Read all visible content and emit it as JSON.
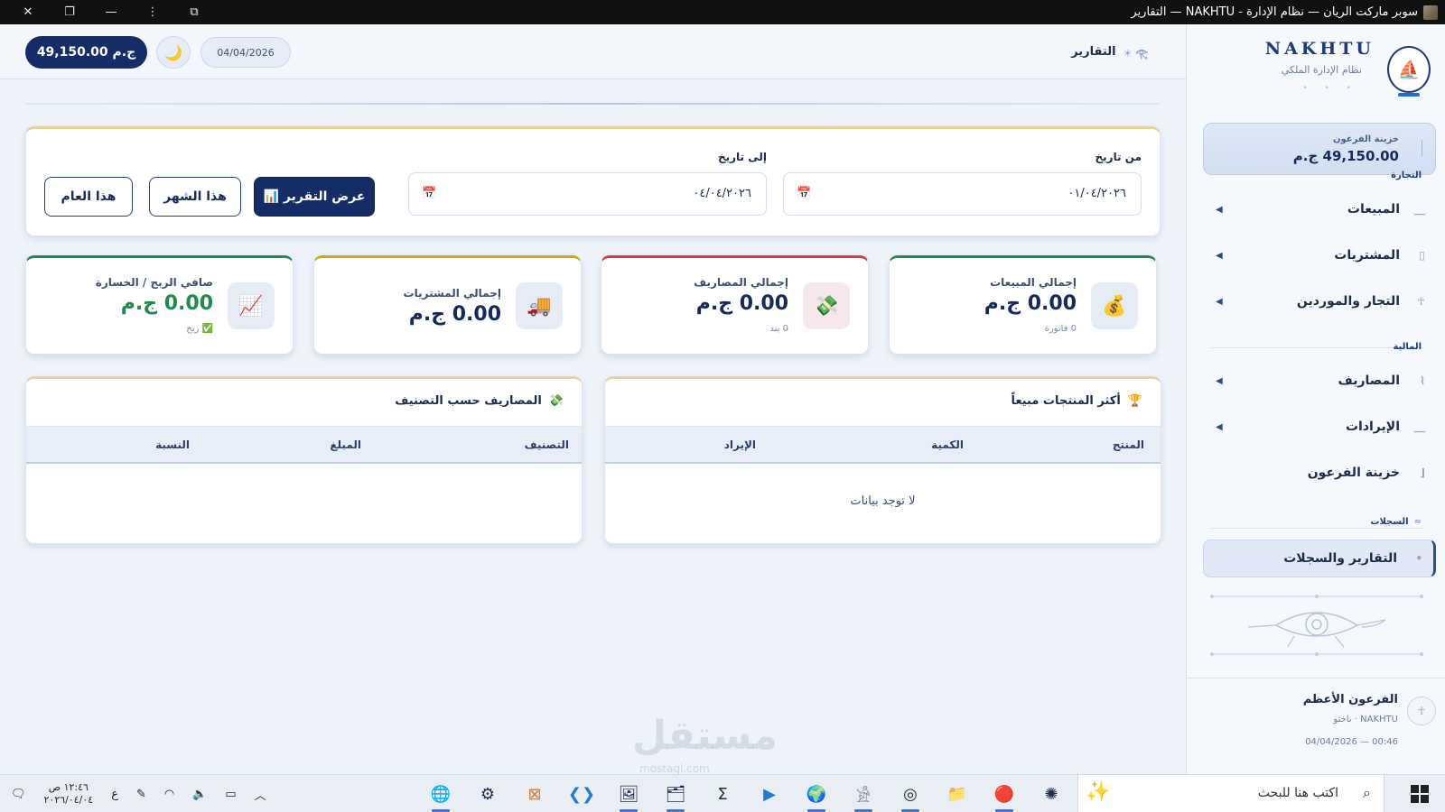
{
  "window": {
    "title": "سوبر ماركت الريان — نظام الإدارة - NAKHTU — التقارير",
    "close": "✕",
    "restore": "❐",
    "minimize": "—",
    "menu": "⋮"
  },
  "sidebar": {
    "brand_name": "NAKHTU",
    "brand_sub": "نظام الإدارة الملكي",
    "treasury_label": "خزينة الفرعون",
    "treasury_value": "49,150.00 ج.م",
    "section_trade": "التجارة",
    "section_finance": "المالية",
    "section_records": "السجلات",
    "items": [
      {
        "label": "المبيعات",
        "icon": "sales-icon",
        "arrow": "◀"
      },
      {
        "label": "المشتريات",
        "icon": "purchases-icon",
        "arrow": "◀"
      },
      {
        "label": "التجار والموردين",
        "icon": "suppliers-icon",
        "arrow": "◀"
      },
      {
        "label": "المصاريف",
        "icon": "expenses-icon",
        "arrow": "◀"
      },
      {
        "label": "الإيرادات",
        "icon": "revenue-icon",
        "arrow": "◀"
      },
      {
        "label": "خزينة الفرعون",
        "icon": "treasury-icon",
        "arrow": ""
      },
      {
        "label": "التقارير والسجلات",
        "icon": "reports-icon",
        "arrow": ""
      }
    ],
    "user_name": "الفرعون الأعظم",
    "user_sub": "NAKHTU · ناختو",
    "user_time": "04/04/2026 — 00:46"
  },
  "header": {
    "title": "التقارير",
    "balance": "49,150.00 ج.م",
    "date": "04/04/2026"
  },
  "filter": {
    "from_label": "من تاريخ",
    "from_value": "٠١/٠٤/٢٠٢٦",
    "to_label": "إلى تاريخ",
    "to_value": "٠٤/٠٤/٢٠٢٦",
    "show_report": "📊 عرض التقرير",
    "this_month": "هذا الشهر",
    "this_year": "هذا العام"
  },
  "stats": [
    {
      "label": "إجمالي المبيعات",
      "value": "0.00 ج.م",
      "sub": "0 فاتورة",
      "icon": "money-bag-icon",
      "accent": "#1f8a4c"
    },
    {
      "label": "إجمالي المصاريف",
      "value": "0.00 ج.م",
      "sub": "0 بند",
      "icon": "money-wings-icon",
      "accent": "#d93a3a"
    },
    {
      "label": "إجمالي المشتريات",
      "value": "0.00 ج.م",
      "sub": "",
      "icon": "truck-icon",
      "accent": "#d9a21c"
    },
    {
      "label": "صافي الربح / الخسارة",
      "value": "0.00 ج.م",
      "sub": "✅ ربح",
      "icon": "chart-up-icon",
      "accent": "#1f8a4c"
    }
  ],
  "top_products": {
    "title": "أكثر المنتجات مبيعاً",
    "columns": [
      "المنتج",
      "الكمية",
      "الإيراد"
    ],
    "empty": "لا توجد بيانات"
  },
  "expenses_by_category": {
    "title": "المصاريف حسب التصنيف",
    "columns": [
      "التصنيف",
      "المبلغ",
      "النسبة"
    ]
  },
  "taskbar": {
    "search_placeholder": "اكتب هنا للبحث",
    "time": "١٢:٤٦ ص",
    "date": "٢٠٢٦/٠٤/٠٤",
    "lang": "ع"
  },
  "watermark": {
    "text": "مستقل",
    "sub": "mostaql.com"
  }
}
